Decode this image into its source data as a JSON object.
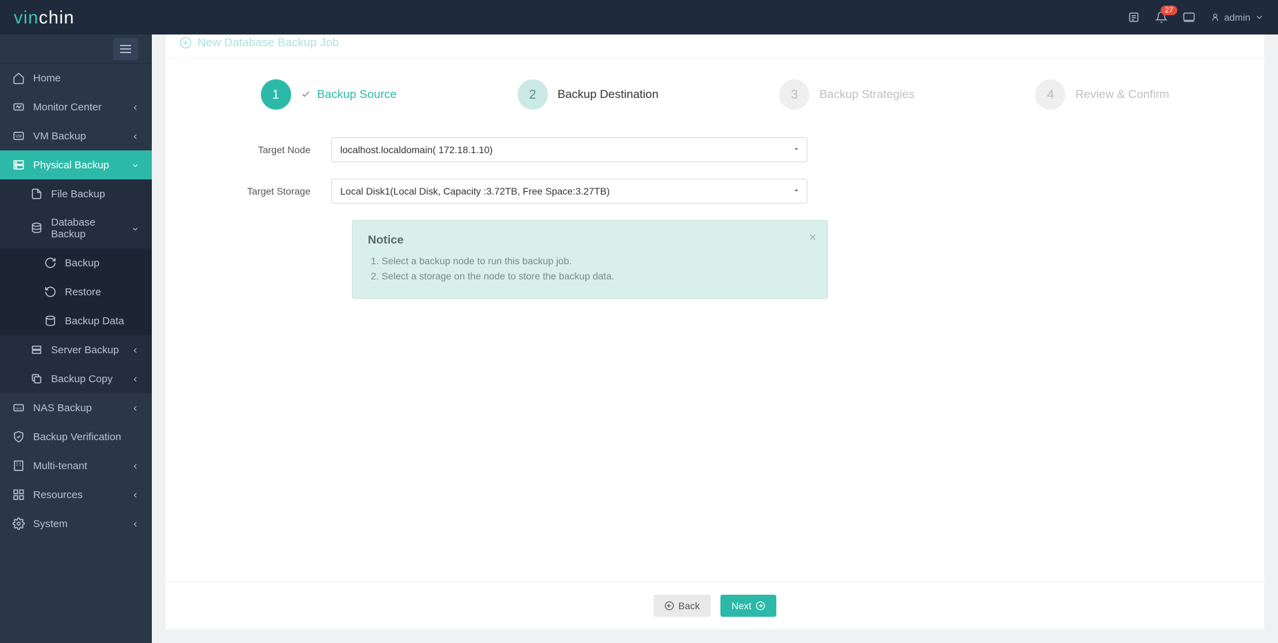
{
  "brand": {
    "part1": "vin",
    "part2": "chin"
  },
  "topbar": {
    "notification_count": "27",
    "username": "admin"
  },
  "sidebar": {
    "items": [
      {
        "label": "Home"
      },
      {
        "label": "Monitor Center"
      },
      {
        "label": "VM Backup"
      },
      {
        "label": "Physical Backup"
      },
      {
        "label": "NAS Backup"
      },
      {
        "label": "Backup Verification"
      },
      {
        "label": "Multi-tenant"
      },
      {
        "label": "Resources"
      },
      {
        "label": "System"
      }
    ],
    "physical_sub": [
      {
        "label": "File Backup"
      },
      {
        "label": "Database Backup"
      },
      {
        "label": "Server Backup"
      },
      {
        "label": "Backup Copy"
      }
    ],
    "db_sub": [
      {
        "label": "Backup"
      },
      {
        "label": "Restore"
      },
      {
        "label": "Backup Data"
      }
    ]
  },
  "page": {
    "title": "New Database Backup Job"
  },
  "steps": [
    {
      "num": "1",
      "label": "Backup Source"
    },
    {
      "num": "2",
      "label": "Backup Destination"
    },
    {
      "num": "3",
      "label": "Backup Strategies"
    },
    {
      "num": "4",
      "label": "Review & Confirm"
    }
  ],
  "form": {
    "target_node_label": "Target Node",
    "target_node_value": "localhost.localdomain( 172.18.1.10)",
    "target_storage_label": "Target Storage",
    "target_storage_value": "Local Disk1(Local Disk, Capacity :3.72TB, Free Space:3.27TB)"
  },
  "notice": {
    "title": "Notice",
    "items": [
      "Select a backup node to run this backup job.",
      "Select a storage on the node to store the backup data."
    ]
  },
  "buttons": {
    "back": "Back",
    "next": "Next"
  }
}
